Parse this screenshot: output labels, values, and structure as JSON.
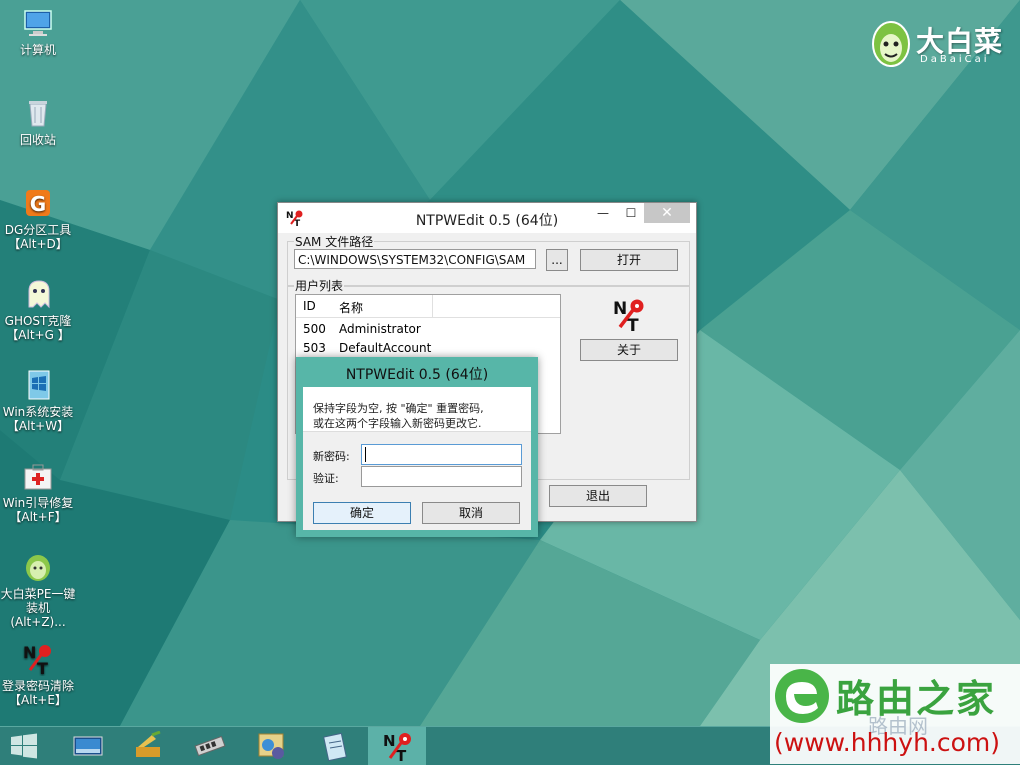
{
  "desktop": {
    "icons": [
      {
        "name": "computer",
        "label": "计算机"
      },
      {
        "name": "recycle-bin",
        "label": "回收站"
      },
      {
        "name": "dg-partition",
        "label": "DG分区工具\n【Alt+D】"
      },
      {
        "name": "ghost",
        "label": "GHOST克隆\n【Alt+G 】"
      },
      {
        "name": "win-install",
        "label": "Win系统安装\n【Alt+W】"
      },
      {
        "name": "boot-repair",
        "label": "Win引导修复\n【Alt+F】"
      },
      {
        "name": "dabaicai-pe",
        "label": "大白菜PE一键\n装机(Alt+Z)..."
      },
      {
        "name": "password-clear",
        "label": "登录密码清除\n【Alt+E】"
      }
    ]
  },
  "brand": {
    "name": "大白菜",
    "sub": "DaBaiCai"
  },
  "main_window": {
    "title": "NTPWEdit 0.5 (64位)",
    "minimize": "—",
    "maximize": "☐",
    "close": "✕",
    "sam_label": "SAM 文件路径",
    "sam_path": "C:\\WINDOWS\\SYSTEM32\\CONFIG\\SAM",
    "browse_label": "...",
    "open_label": "打开",
    "userlist_label": "用户列表",
    "columns": [
      "ID",
      "名称"
    ],
    "users": [
      {
        "id": "500",
        "name": "Administrator"
      },
      {
        "id": "503",
        "name": "DefaultAccount"
      }
    ],
    "about_label": "关于",
    "exit_label": "退出"
  },
  "dialog": {
    "title": "NTPWEdit 0.5 (64位)",
    "message_line1": "保持字段为空, 按 \"确定\" 重置密码,",
    "message_line2": "或在这两个字段输入新密码更改它.",
    "new_password_label": "新密码:",
    "new_password_value": "",
    "verify_label": "验证:",
    "verify_value": "",
    "ok_label": "确定",
    "cancel_label": "取消"
  },
  "watermark": {
    "title": "路由之家",
    "url": "(www.hhhyh.com)",
    "ghost": "路由网"
  },
  "taskbar": {
    "items": [
      "start-icon",
      "desktop-icon",
      "cleaner-icon",
      "memory-icon",
      "network-icon",
      "notepad-icon",
      "ntpwedit-icon"
    ]
  },
  "colors": {
    "dialog_frame": "#57b6a8",
    "taskbar": "#2f7f7a",
    "active_task": "#5cb1a8"
  }
}
